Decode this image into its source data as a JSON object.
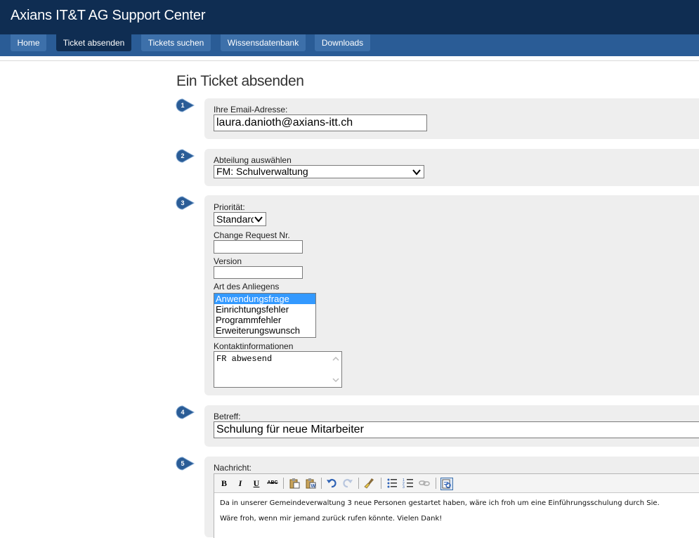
{
  "app": {
    "title": "Axians IT&T AG Support Center"
  },
  "nav": {
    "tabs": [
      {
        "label": "Home"
      },
      {
        "label": "Ticket absenden"
      },
      {
        "label": "Tickets suchen"
      },
      {
        "label": "Wissensdatenbank"
      },
      {
        "label": "Downloads"
      }
    ],
    "active_tab": "Ticket absenden"
  },
  "page": {
    "title": "Ein Ticket absenden"
  },
  "steps": [
    "1",
    "2",
    "3",
    "4",
    "5"
  ],
  "form": {
    "email": {
      "label": "Ihre Email-Adresse:",
      "value": "laura.danioth@axians-itt.ch"
    },
    "department": {
      "label": "Abteilung auswählen",
      "value": "FM: Schulverwaltung"
    },
    "priority": {
      "label": "Priorität:",
      "value": "Standard"
    },
    "change_request": {
      "label": "Change Request Nr.",
      "value": ""
    },
    "version": {
      "label": "Version",
      "value": ""
    },
    "request_type": {
      "label": "Art des Anliegens",
      "options": [
        "Anwendungsfrage",
        "Einrichtungsfehler",
        "Programmfehler",
        "Erweiterungswunsch"
      ],
      "selected": "Anwendungsfrage"
    },
    "contact": {
      "label": "Kontaktinformationen",
      "value": "FR abwesend"
    },
    "subject": {
      "label": "Betreff:",
      "value": "Schulung für neue Mitarbeiter"
    },
    "message": {
      "label": "Nachricht:",
      "lines": [
        "Da in unserer Gemeindeverwaltung 3 neue Personen gestartet haben, wäre ich froh um eine Einführungsschulung durch Sie.",
        "Wäre froh, wenn mir jemand zurück rufen könnte. Vielen Dank!"
      ]
    }
  },
  "editor_toolbar": {
    "bold": "B",
    "italic": "I",
    "underline": "U",
    "strikethrough": "ABC",
    "icons": [
      "paste-icon",
      "paste-word-icon",
      "undo-icon",
      "redo-icon",
      "clean-format-icon",
      "bullet-list-icon",
      "numbered-list-icon",
      "link-icon",
      "source-icon"
    ]
  },
  "colors": {
    "header_bg": "#0f2d52",
    "nav_bg": "#2a5c96",
    "tab_bg": "#3d70aa",
    "step_badge": "#2a5c96",
    "panel_bg": "#eeeeee",
    "list_selected": "#3399ff"
  }
}
